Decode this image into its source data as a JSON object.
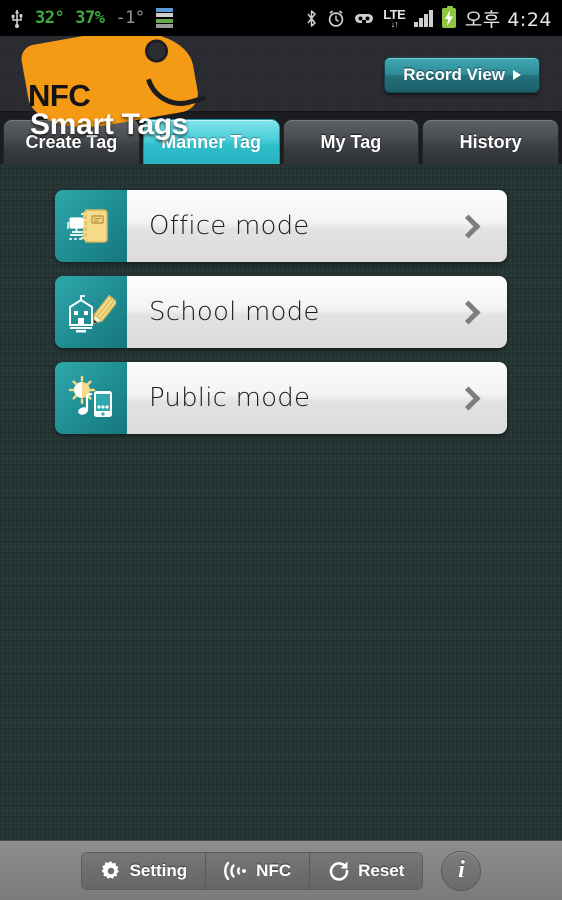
{
  "statusbar": {
    "usb_icon": "usb-icon",
    "temp_outdoor": "32°",
    "humidity": "37%",
    "temp_feels": "-1°",
    "network_icon": "network-activity-icon",
    "bluetooth_icon": "bluetooth-icon",
    "alarm_icon": "alarm-clock-icon",
    "vibrate_icon": "vibrate-mode-icon",
    "lte_label": "LTE",
    "lte_arrows": "↓↑",
    "signal_icon": "signal-bars-icon",
    "battery_icon": "battery-charging-icon",
    "clock": "오후 4:24"
  },
  "header": {
    "logo_line1": "NFC",
    "logo_line2": "Smart Tags",
    "record_button": "Record View",
    "record_arrow_icon": "play-triangle-icon"
  },
  "tabs": [
    {
      "label": "Create Tag",
      "active": false
    },
    {
      "label": "Manner Tag",
      "active": true
    },
    {
      "label": "My Tag",
      "active": false
    },
    {
      "label": "History",
      "active": false
    }
  ],
  "modes": [
    {
      "label": "Office mode",
      "icon": "notebook-computer-icon",
      "chevron": "chevron-right-icon"
    },
    {
      "label": "School mode",
      "icon": "school-pencil-icon",
      "chevron": "chevron-right-icon"
    },
    {
      "label": "Public mode",
      "icon": "sun-phone-music-icon",
      "chevron": "chevron-right-icon"
    }
  ],
  "bottombar": {
    "setting": "Setting",
    "setting_icon": "gear-icon",
    "nfc": "NFC",
    "nfc_icon": "nfc-wave-icon",
    "reset": "Reset",
    "reset_icon": "refresh-icon",
    "info": "i",
    "info_icon": "info-icon"
  },
  "colors": {
    "accent_teal": "#2fbecb",
    "brand_orange": "#f59a14",
    "background": "#253634",
    "header": "#2b2d33"
  }
}
